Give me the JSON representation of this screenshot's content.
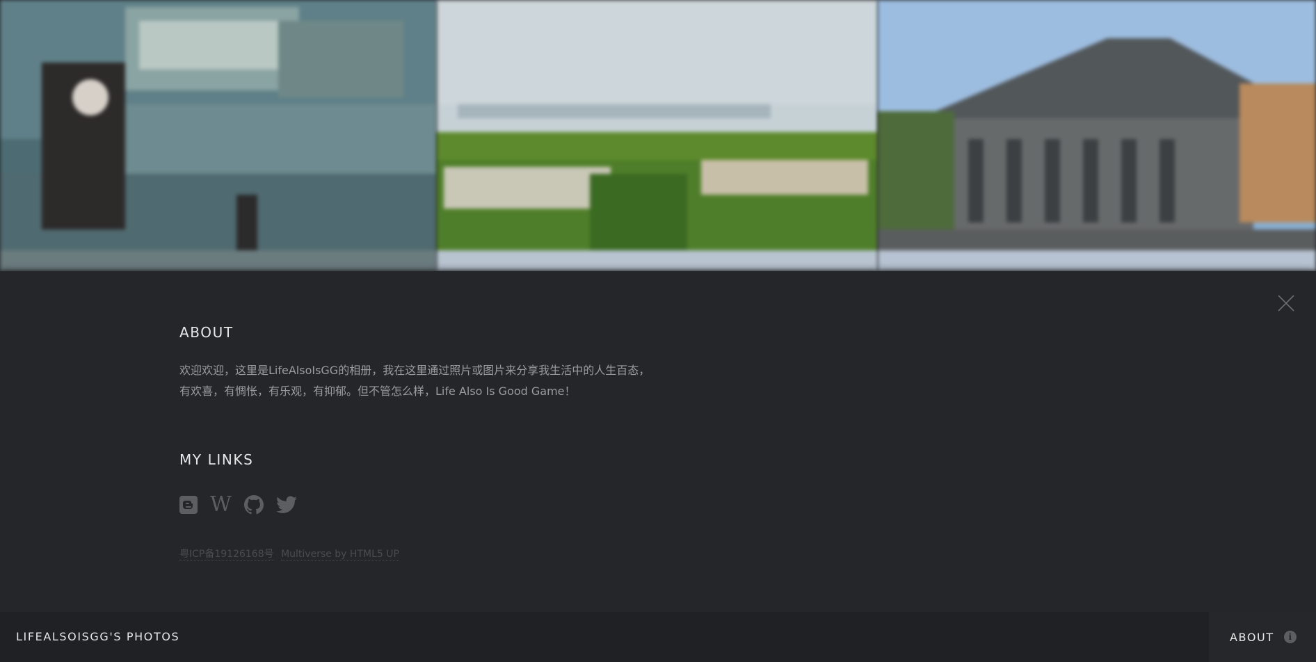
{
  "header": {
    "site_title": "LIFEALSOISGG'S PHOTOS",
    "about_toggle_label": "ABOUT",
    "about_toggle_icon": "info-icon"
  },
  "panel": {
    "about_title": "ABOUT",
    "about_text": "欢迎欢迎，这里是LifeAlsoIsGG的相册，我在这里通过照片或图片来分享我生活中的人生百态，有欢喜，有惆怅，有乐观，有抑郁。但不管怎么样，Life Also Is Good Game！",
    "links_title": "MY LINKS",
    "social_icons": [
      "blogger-icon",
      "wikipedia-icon",
      "github-icon",
      "twitter-icon"
    ],
    "footer": {
      "icp_label": "粤ICP备19126168号",
      "credit_label": "Multiverse by HTML5 UP"
    },
    "close_icon": "close-icon"
  },
  "gallery": {
    "photos": [
      "photo-street-rain",
      "photo-grass-field",
      "photo-building"
    ]
  },
  "colors": {
    "panel_bg": "#242629",
    "header_bg": "#1f2124",
    "title_text": "#e8e8e8",
    "body_text": "#9a9c9f",
    "muted_text": "#5c5e61"
  }
}
